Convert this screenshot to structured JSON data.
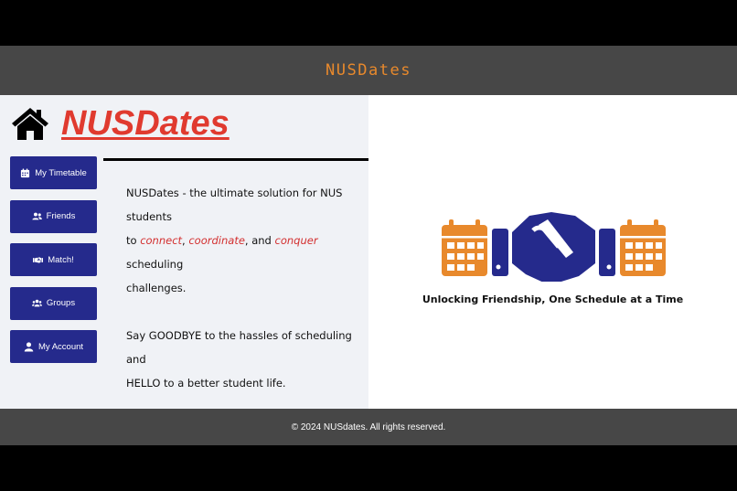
{
  "header": {
    "title": "NUSDates"
  },
  "brand": {
    "title": "NUSDates",
    "icon": "house-icon"
  },
  "nav": {
    "items": [
      {
        "label": "My Timetable",
        "icon": "calendar-icon"
      },
      {
        "label": "Friends",
        "icon": "user-group-icon"
      },
      {
        "label": "Match!",
        "icon": "handshake-icon"
      },
      {
        "label": "Groups",
        "icon": "users-icon"
      },
      {
        "label": "My Account",
        "icon": "user-icon"
      }
    ]
  },
  "intro": {
    "line1": "NUSDates - the ultimate solution for NUS students",
    "to": "to ",
    "connect": "connect",
    "comma1": ", ",
    "coordinate": "coordinate",
    "and": ", and ",
    "conquer": "conquer",
    "scheduling": " scheduling",
    "challenges": "challenges.",
    "line2": "Say GOODBYE to the hassles of scheduling and",
    "line3": "HELLO to a better student life."
  },
  "hero": {
    "tagline": "Unlocking Friendship, One Schedule at a Time",
    "colors": {
      "orange": "#e8892c",
      "navy": "#252a8c"
    }
  },
  "footer": {
    "text": "© 2024 NUSdates. All rights reserved."
  }
}
